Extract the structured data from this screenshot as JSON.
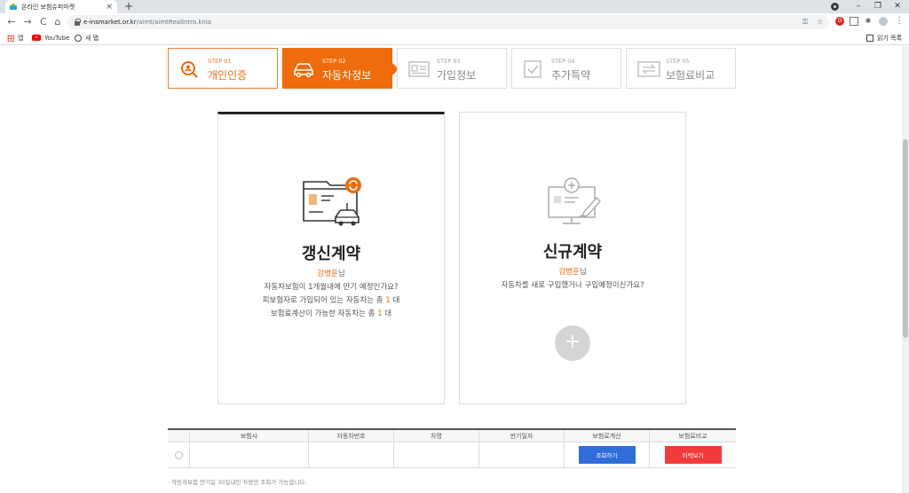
{
  "browser": {
    "tab_title": "온라인 보험슈퍼마켓",
    "tab_close": "×",
    "new_tab": "+",
    "back": "←",
    "forward": "→",
    "reload": "C",
    "home": "⌂",
    "url_host": "e-insmarket.or.kr",
    "url_path": "/aimt/aimtRealIntro.knia",
    "key_icon": "⚿",
    "star_icon": "☆",
    "opera_icon": "O",
    "puzzle_icon": "✱",
    "menu_icon": "⋮",
    "win_minimize": "–",
    "win_maximize": "❐",
    "win_close": "✕"
  },
  "bookmarks": {
    "apps": "앱",
    "youtube": "YouTube",
    "saved": "새 탭",
    "reading_list": "읽기 목록"
  },
  "steps": [
    {
      "num": "STEP 01",
      "name": "개인인증",
      "state": "done"
    },
    {
      "num": "STEP 02",
      "name": "자동차정보",
      "state": "active"
    },
    {
      "num": "STEP 03",
      "name": "가입정보",
      "state": "todo"
    },
    {
      "num": "STEP 04",
      "name": "추가특약",
      "state": "todo"
    },
    {
      "num": "STEP 05",
      "name": "보험료비교",
      "state": "todo"
    }
  ],
  "renewal_card": {
    "title": "갱신계약",
    "user_name": "강병훈",
    "user_suffix": "님",
    "line1": "자동차보험이 1개월내에 만기 예정인가요?",
    "line2_prefix": "피보험자로 가입되어 있는 자동차는 총 ",
    "line2_count": "1",
    "line2_suffix": " 대",
    "line3_prefix": "보험료계산이 가능한 자동차는 총 ",
    "line3_count": "1",
    "line3_suffix": " 대"
  },
  "new_card": {
    "title": "신규계약",
    "user_name": "강병훈",
    "user_suffix": "님",
    "line1": "자동차를 새로 구입했거나 구입예정이신가요?",
    "plus": "+"
  },
  "table": {
    "headers": [
      "",
      "보험사",
      "자동차번호",
      "차명",
      "만기일자",
      "보험료계산",
      "보험료비교"
    ],
    "row": {
      "calc_button": "조회하기",
      "compare_button": "이력보기"
    }
  },
  "note": "· 자동차보험 만기일 30일내인 차량만 조회가 가능합니다.",
  "colors": {
    "accent_orange": "#f06b0c",
    "button_blue": "#2f6ddb",
    "button_red": "#f23b3b"
  }
}
